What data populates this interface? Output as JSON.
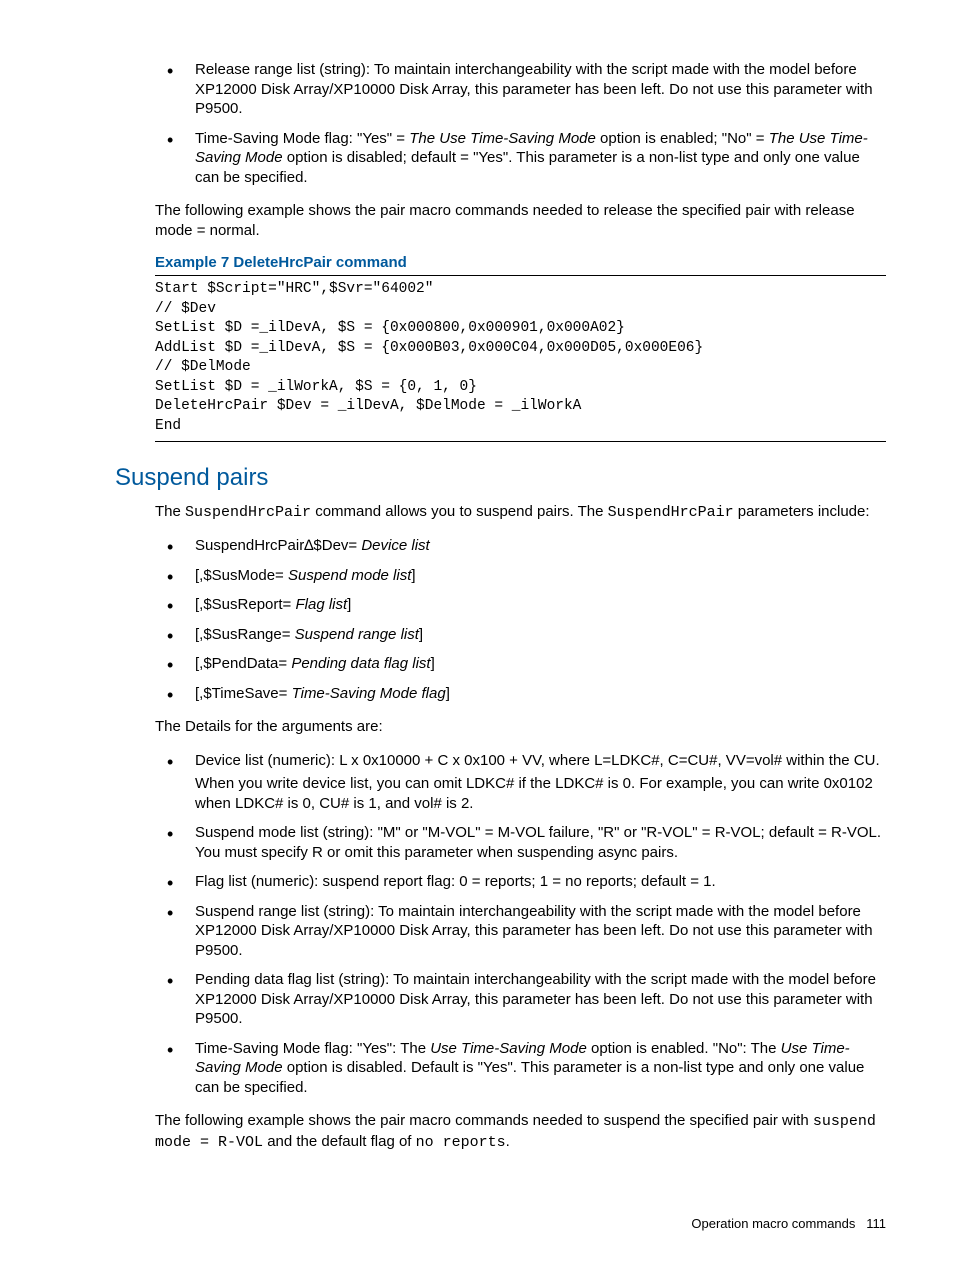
{
  "top_bullets": [
    {
      "text": "Release range list (string): To maintain interchangeability with the script made with the model before XP12000 Disk Array/XP10000 Disk Array, this parameter has been left. Do not use this parameter with P9500."
    },
    {
      "html": "Time-Saving Mode flag: \"Yes\" = <span class=\"italic\">The Use Time-Saving Mode</span> option is enabled; \"No\" = <span class=\"italic\">The Use Time-Saving Mode</span> option is disabled; default = \"Yes\". This parameter is a non-list type and only one value can be specified."
    }
  ],
  "para1": "The following example shows the pair macro commands needed to release the specified pair with release mode = normal.",
  "example_title": "Example 7 DeleteHrcPair command",
  "code": "Start $Script=\"HRC\",$Svr=\"64002\"\n// $Dev\nSetList $D =_ilDevA, $S = {0x000800,0x000901,0x000A02}\nAddList $D =_ilDevA, $S = {0x000B03,0x000C04,0x000D05,0x000E06}\n// $DelMode\nSetList $D = _ilWorkA, $S = {0, 1, 0}\nDeleteHrcPair $Dev = _ilDevA, $DelMode = _ilWorkA\nEnd",
  "section_heading": "Suspend pairs",
  "intro_para_html": "The <span class=\"mono\">SuspendHrcPair</span> command allows you to suspend pairs. The <span class=\"mono\">SuspendHrcPair</span> parameters include:",
  "param_bullets": [
    {
      "html": "SuspendHrcPair∆$Dev= <span class=\"italic\">Device list</span>"
    },
    {
      "html": "[,$SusMode= <span class=\"italic\">Suspend mode list</span>]"
    },
    {
      "html": "[,$SusReport= <span class=\"italic\">Flag list</span>]"
    },
    {
      "html": "[,$SusRange= <span class=\"italic\">Suspend range list</span>]"
    },
    {
      "html": "[,$PendData= <span class=\"italic\">Pending data flag list</span>]"
    },
    {
      "html": "[,$TimeSave= <span class=\"italic\">Time-Saving Mode flag</span>]"
    }
  ],
  "details_intro": "The Details for the arguments are:",
  "detail_bullets": [
    {
      "html": "Device list (numeric): L x 0x10000 + C x 0x100 + VV, where L=LDKC#, C=CU#, VV=vol# within the CU.<div class=\"sub-para\">When you write device list, you can omit LDKC# if the LDKC# is 0. For example, you can write 0x0102 when LDKC# is 0, CU# is 1, and vol# is 2.</div>"
    },
    {
      "text": "Suspend mode list (string): \"M\" or \"M-VOL\" = M-VOL failure, \"R\" or \"R-VOL\" = R-VOL; default = R-VOL. You must specify R or omit this parameter when suspending async pairs."
    },
    {
      "text": "Flag list (numeric): suspend report flag: 0 = reports; 1 = no reports; default = 1."
    },
    {
      "text": "Suspend range list (string): To maintain interchangeability with the script made with the model before XP12000 Disk Array/XP10000 Disk Array, this parameter has been left. Do not use this parameter with P9500."
    },
    {
      "text": "Pending data flag list (string): To maintain interchangeability with the script made with the model before XP12000 Disk Array/XP10000 Disk Array, this parameter has been left. Do not use this parameter with P9500."
    },
    {
      "html": "Time-Saving Mode flag: \"Yes\": The <span class=\"italic\">Use Time-Saving Mode</span> option is enabled. \"No\": The <span class=\"italic\">Use Time-Saving Mode</span> option is disabled. Default is \"Yes\". This parameter is a non-list type and only one value can be specified."
    }
  ],
  "closing_para_html": "The following example shows the pair macro commands needed to suspend the specified pair with <span class=\"mono\">suspend mode = R-VOL</span> and the default flag of <span class=\"mono\">no reports</span>.",
  "footer_text": "Operation macro commands",
  "footer_page": "111"
}
